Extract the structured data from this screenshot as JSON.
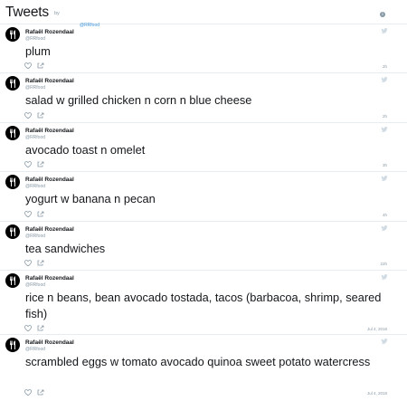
{
  "header": {
    "title": "Tweets",
    "by": "by",
    "handle": "@RRfood",
    "info_icon": "info-icon"
  },
  "tweets": [
    {
      "name": "Rafaël Rozendaal",
      "handle": "@RRfood",
      "text": "plum",
      "time": "2h"
    },
    {
      "name": "Rafaël Rozendaal",
      "handle": "@RRfood",
      "text": "salad w grilled chicken n corn n blue cheese",
      "time": "2h"
    },
    {
      "name": "Rafaël Rozendaal",
      "handle": "@RRfood",
      "text": "avocado toast n omelet",
      "time": "3h"
    },
    {
      "name": "Rafaël Rozendaal",
      "handle": "@RRfood",
      "text": "yogurt w banana n pecan",
      "time": "4h"
    },
    {
      "name": "Rafaël Rozendaal",
      "handle": "@RRfood",
      "text": "tea sandwiches",
      "time": "22h"
    },
    {
      "name": "Rafaël Rozendaal",
      "handle": "@RRfood",
      "text": "rice n beans, bean avocado tostada, tacos (barbacoa, shrimp, seared fish)",
      "time": "Jul 4, 2018"
    },
    {
      "name": "Rafaël Rozendaal",
      "handle": "@RRfood",
      "text": "scrambled eggs w tomato avocado quinoa sweet potato watercress",
      "time": "Jul 4, 2018"
    }
  ],
  "icons": {
    "avatar": "fork-knife-icon",
    "bird": "twitter-bird-icon",
    "like": "heart-icon",
    "share": "share-icon"
  },
  "colors": {
    "text": "#14171a",
    "muted": "#8899a6",
    "link": "#3b94d9",
    "divider": "#e6ecf0"
  }
}
